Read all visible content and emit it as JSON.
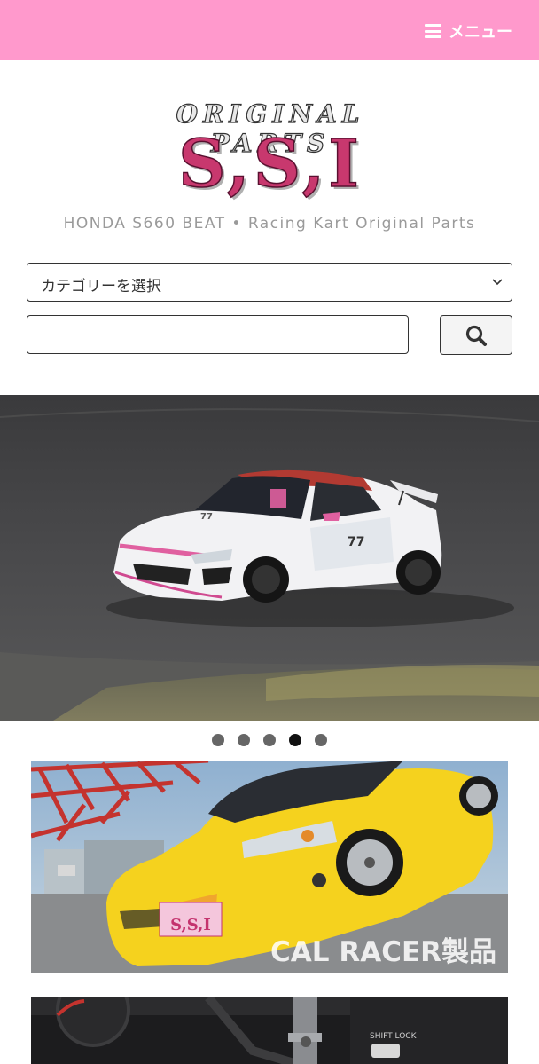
{
  "header": {
    "menu_label": "メニュー",
    "background": "#ff99cc"
  },
  "logo": {
    "top_text": "ORIGINAL PARTS",
    "main_text": "S,S,I"
  },
  "tagline": "HONDA S660 BEAT • Racing Kart Original Parts",
  "category_select": {
    "selected": "カテゴリーを選択"
  },
  "search": {
    "value": "",
    "button_icon": "search-icon"
  },
  "slider": {
    "total_slides": 5,
    "active_index": 3
  },
  "banner1": {
    "overlay_text": "CAL RACER製品",
    "plate_text": "S,S,I"
  },
  "banner2": {
    "shift_lock_text": "SHIFT LOCK"
  }
}
